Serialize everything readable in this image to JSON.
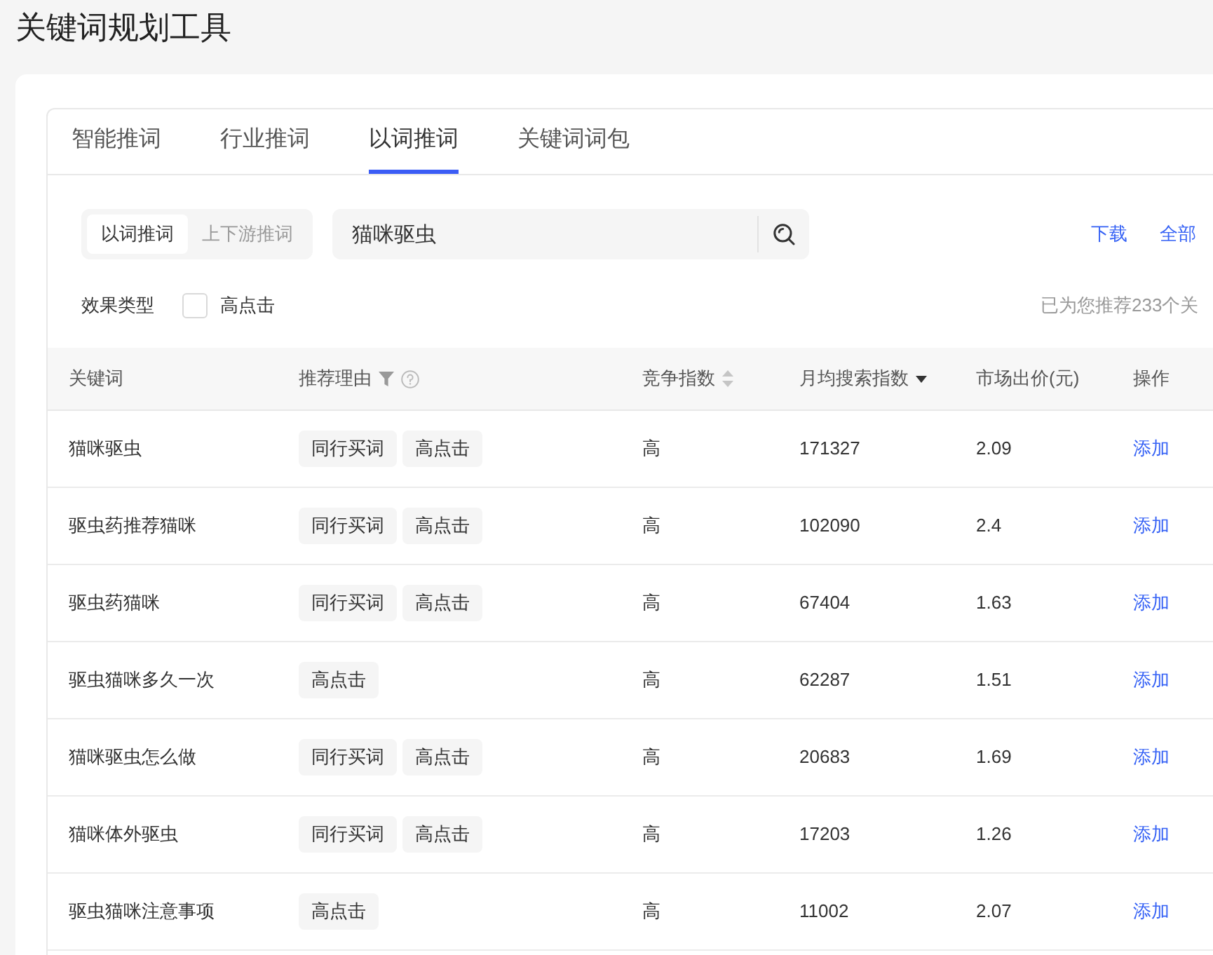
{
  "page": {
    "title": "关键词规划工具"
  },
  "tabs": [
    {
      "label": "智能推词",
      "selected": false
    },
    {
      "label": "行业推词",
      "selected": false
    },
    {
      "label": "以词推词",
      "selected": true
    },
    {
      "label": "关键词词包",
      "selected": false
    }
  ],
  "mode_switch": [
    {
      "label": "以词推词",
      "selected": true
    },
    {
      "label": "上下游推词",
      "selected": false
    }
  ],
  "search": {
    "value": "猫咪驱虫"
  },
  "links": [
    "下载",
    "全部"
  ],
  "filter": {
    "label": "效果类型",
    "option": {
      "label": "高点击",
      "checked": false
    }
  },
  "summary": "已为您推荐233个关",
  "table": {
    "columns": [
      {
        "label": "关键词"
      },
      {
        "label": "推荐理由",
        "filter": true,
        "help": true
      },
      {
        "label": "竞争指数",
        "sortable": true,
        "sorted_desc": false
      },
      {
        "label": "月均搜索指数",
        "sortable": true,
        "sorted_desc": true
      },
      {
        "label": "市场出价(元)"
      },
      {
        "label": "操作"
      }
    ],
    "rows": [
      {
        "keyword": "猫咪驱虫",
        "reasons": [
          "同行买词",
          "高点击"
        ],
        "competition": "高",
        "search_index": "171327",
        "price": "2.09",
        "action": "添加"
      },
      {
        "keyword": "驱虫药推荐猫咪",
        "reasons": [
          "同行买词",
          "高点击"
        ],
        "competition": "高",
        "search_index": "102090",
        "price": "2.4",
        "action": "添加"
      },
      {
        "keyword": "驱虫药猫咪",
        "reasons": [
          "同行买词",
          "高点击"
        ],
        "competition": "高",
        "search_index": "67404",
        "price": "1.63",
        "action": "添加"
      },
      {
        "keyword": "驱虫猫咪多久一次",
        "reasons": [
          "高点击"
        ],
        "competition": "高",
        "search_index": "62287",
        "price": "1.51",
        "action": "添加"
      },
      {
        "keyword": "猫咪驱虫怎么做",
        "reasons": [
          "同行买词",
          "高点击"
        ],
        "competition": "高",
        "search_index": "20683",
        "price": "1.69",
        "action": "添加"
      },
      {
        "keyword": "猫咪体外驱虫",
        "reasons": [
          "同行买词",
          "高点击"
        ],
        "competition": "高",
        "search_index": "17203",
        "price": "1.26",
        "action": "添加"
      },
      {
        "keyword": "驱虫猫咪注意事项",
        "reasons": [
          "高点击"
        ],
        "competition": "高",
        "search_index": "11002",
        "price": "2.07",
        "action": "添加"
      }
    ]
  }
}
